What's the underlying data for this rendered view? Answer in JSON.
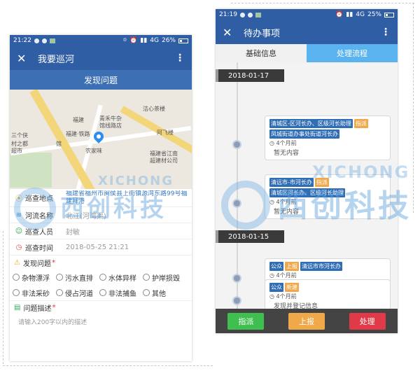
{
  "left": {
    "status": {
      "time": "21:22",
      "net": "4G",
      "battery": "26%"
    },
    "appbar": {
      "title": "我要巡河",
      "more": "⋮",
      "close": "✕"
    },
    "subheader": "发现问题",
    "map_labels": [
      "洁心茶楼",
      "青禾牛杂",
      "馆线路店",
      "福建",
      "福建·铁路",
      "馆",
      "三个侠",
      "农家味",
      "福建省江南",
      "超建材公司",
      "阿飞楼",
      "村之都",
      "超市"
    ],
    "fields": [
      {
        "label": "巡查地点",
        "value": "福建省福州市闽侯县上街镇源湾东路99号福建拜港"
      },
      {
        "label": "河流名称",
        "value": "北江(河湾渠)"
      },
      {
        "label": "巡查人员",
        "value": "封敏"
      },
      {
        "label": "巡查时间",
        "value": "2018-05-25 21:21"
      }
    ],
    "problem_title": "发现问题",
    "required_mark": "*",
    "options": [
      "杂物漂浮",
      "污水直排",
      "水体异样",
      "护岸损毁",
      "非法采砂",
      "侵占河道",
      "非法捕鱼",
      "其他"
    ],
    "desc_title": "问题描述",
    "desc_placeholder": "请输入200字以内的描述"
  },
  "right": {
    "status": {
      "time": "21:19",
      "net": "4G",
      "battery": "25%"
    },
    "appbar": {
      "title": "待办事项",
      "more": "⋮",
      "close": "✕"
    },
    "tabs": [
      {
        "label": "基础信息",
        "active": false
      },
      {
        "label": "处理流程",
        "active": true
      }
    ],
    "dates": [
      "2018-01-17",
      "2018-01-15"
    ],
    "cards": [
      {
        "tags": [
          {
            "text": "清城区-区河长办、区级河长助理",
            "color": "blue"
          },
          {
            "text": "指派",
            "color": "orange"
          },
          {
            "text": "凤城街道办事处街道河长办",
            "color": "blue"
          }
        ],
        "time": "4个月前",
        "note": "暂无内容"
      },
      {
        "tags": [
          {
            "text": "清远市-市河长办",
            "color": "blue"
          },
          {
            "text": "指派",
            "color": "orange"
          },
          {
            "text": "清城区河长办、区级河长助理",
            "color": "blue"
          }
        ],
        "time": "4个月前",
        "note": "暂无内容"
      },
      {
        "tags": [
          {
            "text": "公众",
            "color": "blue"
          },
          {
            "text": "上报",
            "color": "orange"
          },
          {
            "text": "清远市市河长办",
            "color": "blue"
          }
        ],
        "time": "4个月前",
        "note": ""
      },
      {
        "tags": [
          {
            "text": "公众",
            "color": "blue"
          },
          {
            "text": "新建",
            "color": "orange"
          }
        ],
        "time": "4个月前",
        "note": "发现并登记信息"
      }
    ],
    "buttons": [
      "指派",
      "上报",
      "处理"
    ]
  },
  "watermark": {
    "en": "XICHONG",
    "cn": "西创科技"
  }
}
